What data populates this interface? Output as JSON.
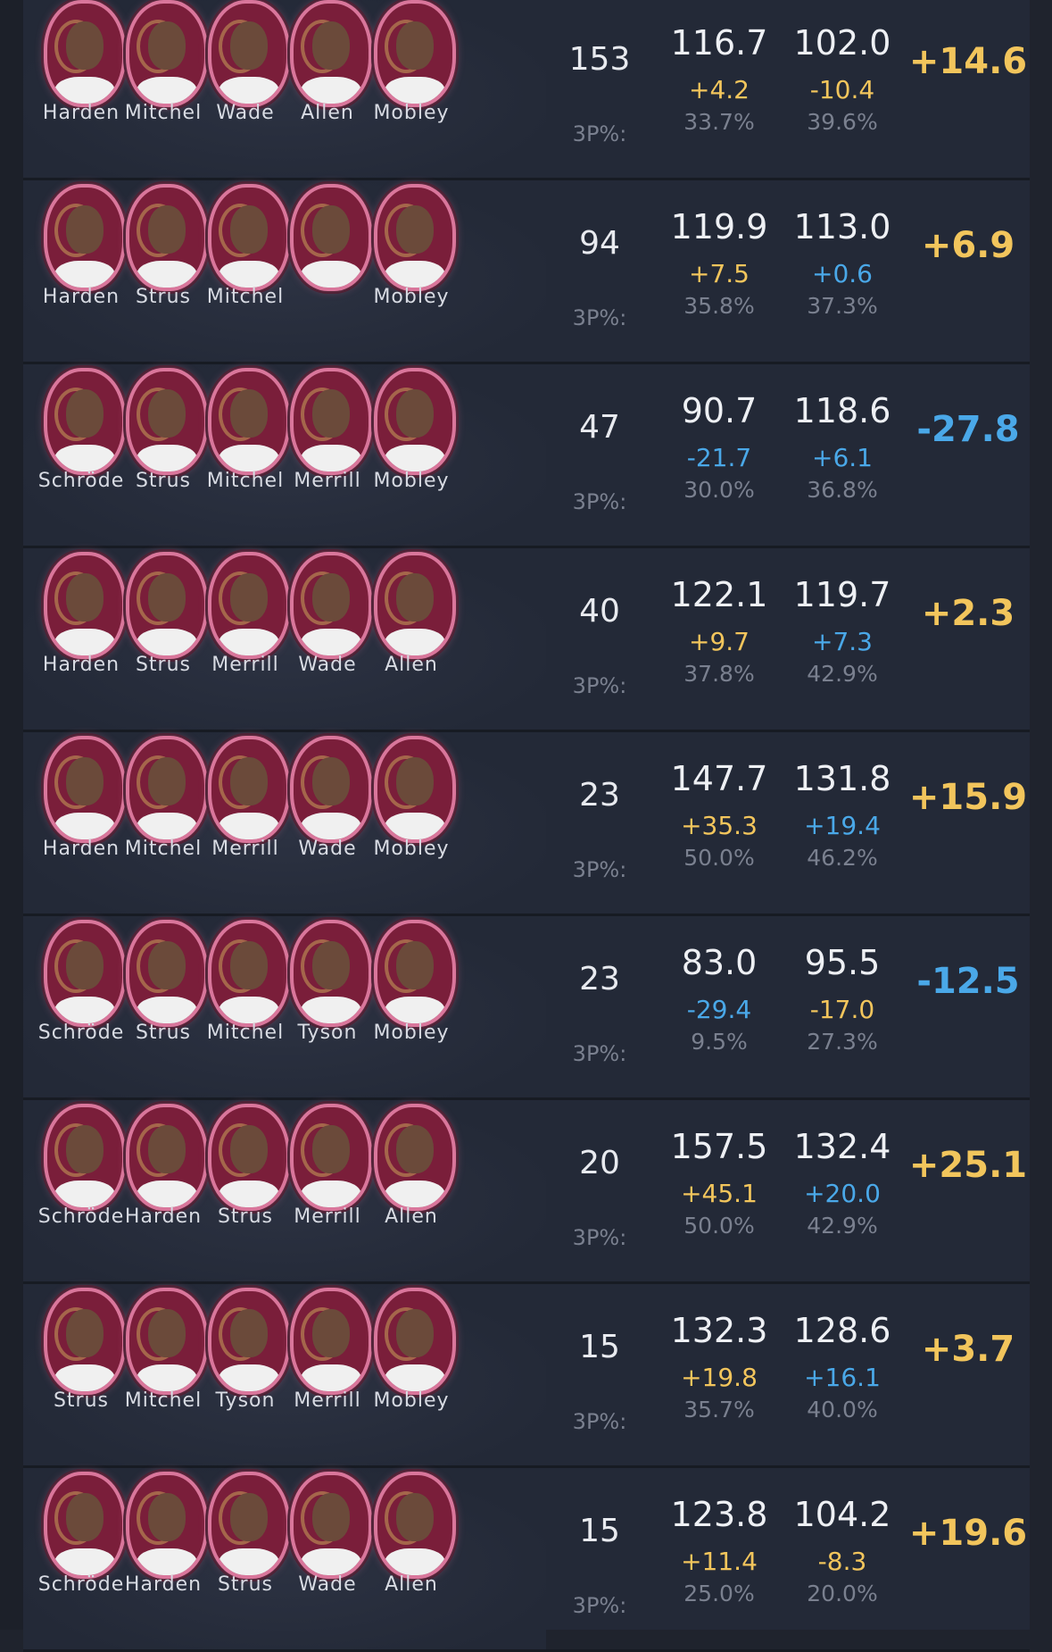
{
  "colors": {
    "positive": "#f2c55c",
    "negative": "#4aa8e8"
  },
  "three_pt_label": "3P%:",
  "rows": [
    {
      "players": [
        "Harden",
        "Mitchel",
        "Wade",
        "Allen",
        "Mobley"
      ],
      "poss": "153",
      "ortg": "116.7",
      "drtg": "102.0",
      "ortg_diff": "+4.2",
      "drtg_diff": "-10.4",
      "ortg_3p": "33.7%",
      "drtg_3p": "39.6%",
      "net": "+14.6",
      "ortg_diff_sign": "pos",
      "drtg_diff_sign": "pos",
      "net_sign": "pos"
    },
    {
      "players": [
        "Harden",
        "Strus",
        "Mitchel",
        "",
        "Mobley"
      ],
      "poss": "94",
      "ortg": "119.9",
      "drtg": "113.0",
      "ortg_diff": "+7.5",
      "drtg_diff": "+0.6",
      "ortg_3p": "35.8%",
      "drtg_3p": "37.3%",
      "net": "+6.9",
      "ortg_diff_sign": "pos",
      "drtg_diff_sign": "neg",
      "net_sign": "pos"
    },
    {
      "players": [
        "Schröde",
        "Strus",
        "Mitchel",
        "Merrill",
        "Mobley"
      ],
      "poss": "47",
      "ortg": "90.7",
      "drtg": "118.6",
      "ortg_diff": "-21.7",
      "drtg_diff": "+6.1",
      "ortg_3p": "30.0%",
      "drtg_3p": "36.8%",
      "net": "-27.8",
      "ortg_diff_sign": "neg",
      "drtg_diff_sign": "neg",
      "net_sign": "neg"
    },
    {
      "players": [
        "Harden",
        "Strus",
        "Merrill",
        "Wade",
        "Allen"
      ],
      "poss": "40",
      "ortg": "122.1",
      "drtg": "119.7",
      "ortg_diff": "+9.7",
      "drtg_diff": "+7.3",
      "ortg_3p": "37.8%",
      "drtg_3p": "42.9%",
      "net": "+2.3",
      "ortg_diff_sign": "pos",
      "drtg_diff_sign": "neg",
      "net_sign": "pos"
    },
    {
      "players": [
        "Harden",
        "Mitchel",
        "Merrill",
        "Wade",
        "Mobley"
      ],
      "poss": "23",
      "ortg": "147.7",
      "drtg": "131.8",
      "ortg_diff": "+35.3",
      "drtg_diff": "+19.4",
      "ortg_3p": "50.0%",
      "drtg_3p": "46.2%",
      "net": "+15.9",
      "ortg_diff_sign": "pos",
      "drtg_diff_sign": "neg",
      "net_sign": "pos"
    },
    {
      "players": [
        "Schröde",
        "Strus",
        "Mitchel",
        "Tyson",
        "Mobley"
      ],
      "poss": "23",
      "ortg": "83.0",
      "drtg": "95.5",
      "ortg_diff": "-29.4",
      "drtg_diff": "-17.0",
      "ortg_3p": "9.5%",
      "drtg_3p": "27.3%",
      "net": "-12.5",
      "ortg_diff_sign": "neg",
      "drtg_diff_sign": "pos",
      "net_sign": "neg"
    },
    {
      "players": [
        "Schröde",
        "Harden",
        "Strus",
        "Merrill",
        "Allen"
      ],
      "poss": "20",
      "ortg": "157.5",
      "drtg": "132.4",
      "ortg_diff": "+45.1",
      "drtg_diff": "+20.0",
      "ortg_3p": "50.0%",
      "drtg_3p": "42.9%",
      "net": "+25.1",
      "ortg_diff_sign": "pos",
      "drtg_diff_sign": "neg",
      "net_sign": "pos"
    },
    {
      "players": [
        "Strus",
        "Mitchel",
        "Tyson",
        "Merrill",
        "Mobley"
      ],
      "poss": "15",
      "ortg": "132.3",
      "drtg": "128.6",
      "ortg_diff": "+19.8",
      "drtg_diff": "+16.1",
      "ortg_3p": "35.7%",
      "drtg_3p": "40.0%",
      "net": "+3.7",
      "ortg_diff_sign": "pos",
      "drtg_diff_sign": "neg",
      "net_sign": "pos"
    },
    {
      "players": [
        "Schröde",
        "Harden",
        "Strus",
        "Wade",
        "Allen"
      ],
      "poss": "15",
      "ortg": "123.8",
      "drtg": "104.2",
      "ortg_diff": "+11.4",
      "drtg_diff": "-8.3",
      "ortg_3p": "25.0%",
      "drtg_3p": "20.0%",
      "net": "+19.6",
      "ortg_diff_sign": "pos",
      "drtg_diff_sign": "pos",
      "net_sign": "pos"
    }
  ]
}
